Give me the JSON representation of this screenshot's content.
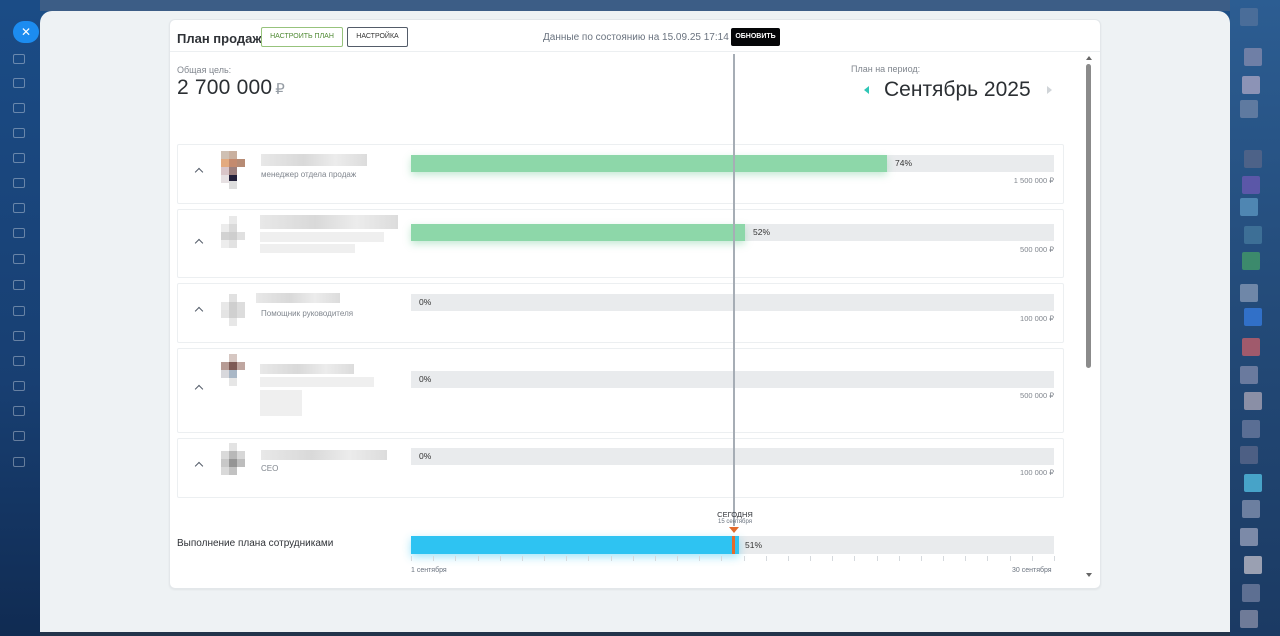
{
  "widget": {
    "title": "План продаж",
    "configure_plan_label": "Настроить план",
    "settings_label": "Настройка",
    "updated_text": "Данные по состоянию на 15.09.25 17:14",
    "refresh_label": "Обновить"
  },
  "goal": {
    "label": "Общая цель:",
    "value": "2 700 000",
    "currency": "₽"
  },
  "period": {
    "label": "План на период:",
    "value": "Сентябрь 2025"
  },
  "employees": [
    {
      "role": "менеджер отдела продаж",
      "percent": 74,
      "percent_label": "74%",
      "target": "1 500 000 ₽"
    },
    {
      "role": "",
      "percent": 52,
      "percent_label": "52%",
      "target": "500 000 ₽"
    },
    {
      "role": "Помощник руководителя",
      "percent": 0,
      "percent_label": "0%",
      "target": "100 000 ₽"
    },
    {
      "role": "",
      "percent": 0,
      "percent_label": "0%",
      "target": "500 000 ₽"
    },
    {
      "role": "CEO",
      "percent": 0,
      "percent_label": "0%",
      "target": "100 000 ₽"
    }
  ],
  "summary": {
    "label": "Выполнение плана сотрудниками",
    "percent": 51,
    "percent_label": "51%",
    "today_label": "Сегодня",
    "today_date": "15 сентября",
    "today_fraction": 0.5,
    "axis_start": "1 сентября",
    "axis_end": "30 сентября"
  },
  "colors": {
    "employee_bar": "#8dd7a9",
    "summary_bar": "#2ec3f2",
    "today_marker": "#e36b2c",
    "track": "#e9ebed"
  },
  "icons": {
    "close": "close-icon",
    "expand": "chevron-up-icon",
    "prev": "triangle-left-icon",
    "next": "triangle-right-icon"
  }
}
